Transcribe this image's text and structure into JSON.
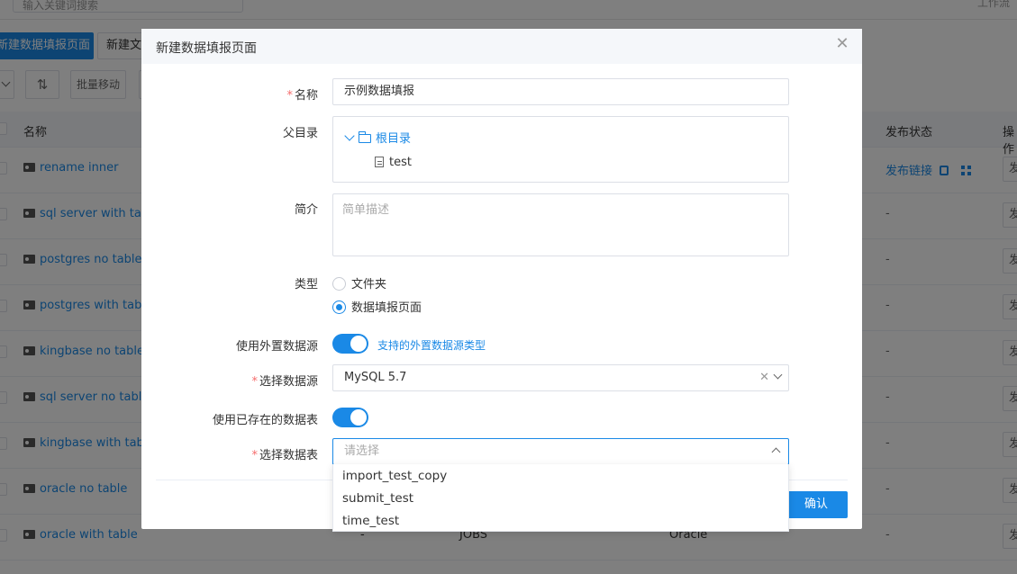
{
  "background": {
    "search_placeholder": "输入关键词搜索",
    "topbar_right": "工作流",
    "new_form_page_button": "新建数据填报页面",
    "new_doc_button": "新建文档",
    "sort_icon_text": "⇅",
    "batch_move_button": "批量移动",
    "table_headers": {
      "name": "名称",
      "publish_status": "发布状态",
      "operation": "操作"
    },
    "rows": [
      {
        "name": "rename inner",
        "status": "发布链接",
        "op": "发"
      },
      {
        "name": "sql server with table",
        "status": "-",
        "op": "发"
      },
      {
        "name": "postgres no table",
        "status": "-",
        "op": "发"
      },
      {
        "name": "postgres with table",
        "status": "-",
        "op": "发"
      },
      {
        "name": "kingbase no table",
        "status": "-",
        "op": "发"
      },
      {
        "name": "sql server no table",
        "status": "-",
        "op": "发"
      },
      {
        "name": "kingbase with table",
        "status": "-",
        "op": "发"
      },
      {
        "name": "oracle no table",
        "status": "-",
        "op": "发"
      },
      {
        "name": "oracle with table",
        "status": "-",
        "op": "发",
        "col_a": "-",
        "col_b": "JOBS",
        "col_c": "Oracle"
      }
    ]
  },
  "modal": {
    "title": "新建数据填报页面",
    "close_icon": "close-icon",
    "fields": {
      "name_label": "名称",
      "name_value": "示例数据填报",
      "parent_label": "父目录",
      "tree_root": "根目录",
      "tree_child": "test",
      "desc_label": "简介",
      "desc_placeholder": "简单描述",
      "type_label": "类型",
      "type_option_folder": "文件夹",
      "type_option_form": "数据填报页面",
      "ext_source_label": "使用外置数据源",
      "ext_source_link": "支持的外置数据源类型",
      "select_source_label": "选择数据源",
      "select_source_value": "MySQL 5.7",
      "use_existing_label": "使用已存在的数据表",
      "select_table_label": "选择数据表",
      "select_table_placeholder": "请选择"
    },
    "confirm_button": "确认",
    "dropdown_options": [
      "import_test_copy",
      "submit_test",
      "time_test"
    ]
  },
  "colors": {
    "primary": "#1a89e6",
    "required": "#f56c6c",
    "overlay": "rgba(0,0,0,0.5)"
  }
}
